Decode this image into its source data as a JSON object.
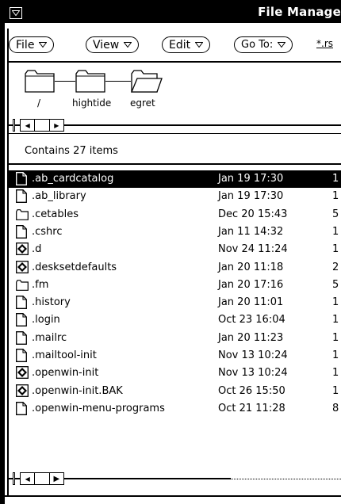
{
  "window": {
    "title": "File Manage"
  },
  "control_bar": {
    "menus": [
      {
        "label": "File"
      },
      {
        "label": "View"
      },
      {
        "label": "Edit"
      },
      {
        "label": "Go To:"
      }
    ],
    "filter_text": "*.rs"
  },
  "path": {
    "folders": [
      {
        "label": "/"
      },
      {
        "label": "hightide"
      },
      {
        "label": "egret"
      }
    ]
  },
  "status": {
    "count_text": "Contains 27 items"
  },
  "files": [
    {
      "name": ".ab_cardcatalog",
      "date": "Jan 19 17:30",
      "size": "1",
      "icon": "document-icon",
      "selected": true
    },
    {
      "name": ".ab_library",
      "date": "Jan 19 17:30",
      "size": "1",
      "icon": "document-icon"
    },
    {
      "name": ".cetables",
      "date": "Dec 20 15:43",
      "size": "5",
      "icon": "folder-icon"
    },
    {
      "name": ".cshrc",
      "date": "Jan 11 14:32",
      "size": "1",
      "icon": "document-icon"
    },
    {
      "name": ".d",
      "date": "Nov 24 11:24",
      "size": "1",
      "icon": "application-icon"
    },
    {
      "name": ".desksetdefaults",
      "date": "Jan 20 11:18",
      "size": "2",
      "icon": "application-icon"
    },
    {
      "name": ".fm",
      "date": "Jan 20 17:16",
      "size": "5",
      "icon": "folder-icon"
    },
    {
      "name": ".history",
      "date": "Jan 20 11:01",
      "size": "1",
      "icon": "document-icon"
    },
    {
      "name": ".login",
      "date": "Oct 23 16:04",
      "size": "1",
      "icon": "document-icon"
    },
    {
      "name": ".mailrc",
      "date": "Jan 20 11:23",
      "size": "1",
      "icon": "document-icon"
    },
    {
      "name": ".mailtool-init",
      "date": "Nov 13 10:24",
      "size": "1",
      "icon": "document-icon"
    },
    {
      "name": ".openwin-init",
      "date": "Nov 13 10:24",
      "size": "1",
      "icon": "application-icon"
    },
    {
      "name": ".openwin-init.BAK",
      "date": "Oct 26 15:50",
      "size": "1",
      "icon": "application-icon"
    },
    {
      "name": ".openwin-menu-programs",
      "date": "Oct 21 11:28",
      "size": "8",
      "icon": "document-icon"
    }
  ]
}
